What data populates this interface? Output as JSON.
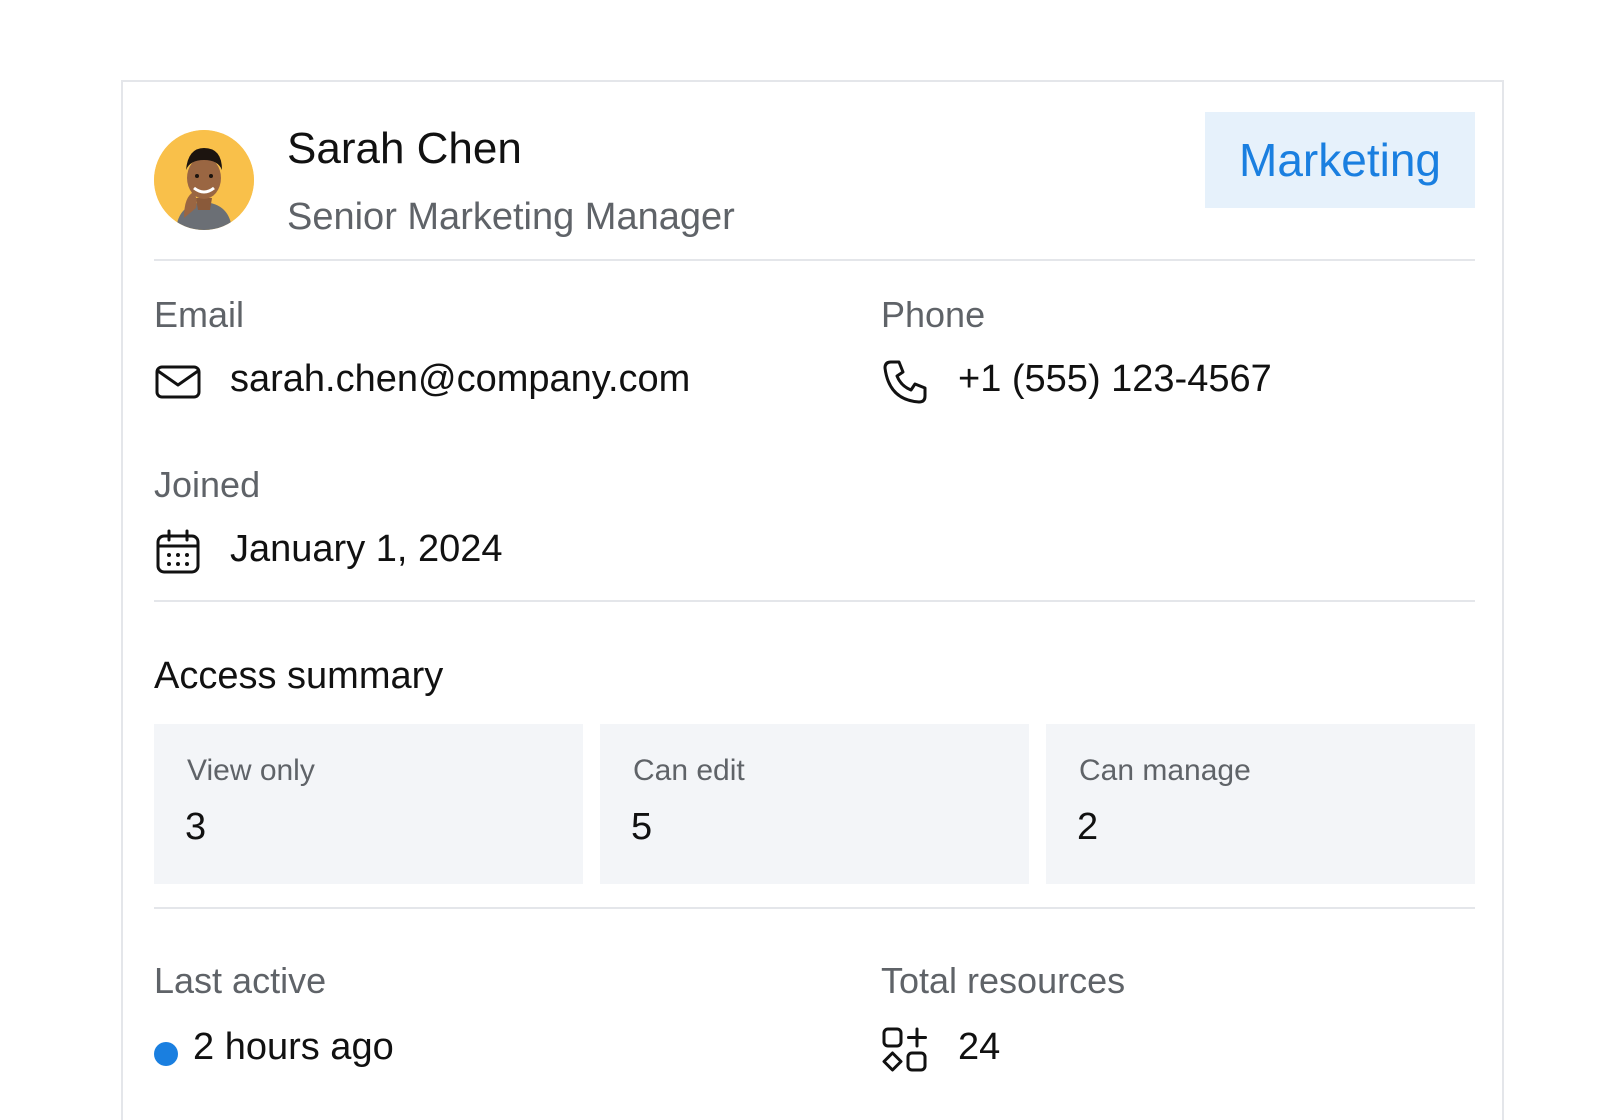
{
  "profile": {
    "name": "Sarah Chen",
    "title": "Senior Marketing Manager",
    "department": "Marketing",
    "avatar_icon": "person-avatar"
  },
  "contact": {
    "email_label": "Email",
    "email_value": "sarah.chen@company.com",
    "email_icon": "mail-icon",
    "phone_label": "Phone",
    "phone_value": "+1 (555) 123-4567",
    "phone_icon": "phone-icon",
    "joined_label": "Joined",
    "joined_value": "January 1, 2024",
    "joined_icon": "calendar-icon"
  },
  "access": {
    "title": "Access summary",
    "items": [
      {
        "label": "View only",
        "value": "3"
      },
      {
        "label": "Can edit",
        "value": "5"
      },
      {
        "label": "Can manage",
        "value": "2"
      }
    ]
  },
  "activity": {
    "last_active_label": "Last active",
    "last_active_value": "2 hours ago",
    "total_resources_label": "Total resources",
    "total_resources_value": "24",
    "resources_icon": "apps-icon"
  },
  "colors": {
    "accent": "#1a7fe0",
    "badge_bg": "#e6f1fb",
    "stat_bg": "#f3f5f8",
    "avatar_bg": "#f9c04a",
    "divider": "#e4e6ea"
  }
}
